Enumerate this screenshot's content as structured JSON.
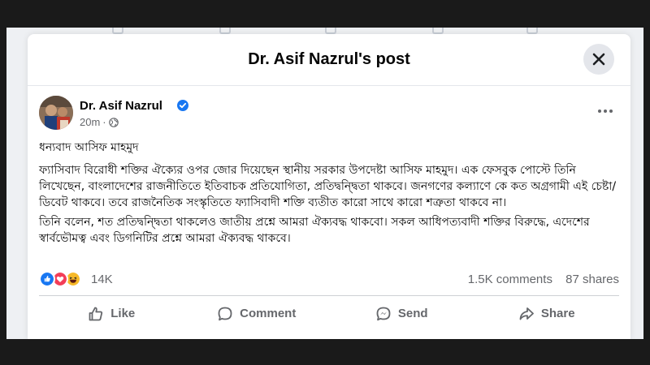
{
  "modal": {
    "title": "Dr. Asif Nazrul's post"
  },
  "post": {
    "author": "Dr. Asif Nazrul",
    "time": "20m",
    "dot": "·",
    "heading": "ধন্যবাদ আসিফ মাহমুদ",
    "lines": [
      "ফ্যাসিবাদ বিরোধী শক্তির ঐক্যের ওপর জোর দিয়েছেন স্থানীয় সরকার উপদেষ্টা আসিফ মাহমুদ। এক ফেসবুক পোস্টে তিনি লিখেছেন, বাংলাদেশের রাজনীতিতে ইতিবাচক প্রতিযোগিতা, প্রতিদ্বন্দ্বিতা থাকবে। জনগণের কল্যাণে কে কত অগ্রগামী এই চেষ্টা/ডিবেট থাকবে। তবে রাজনৈতিক সংস্কৃতিতে ফ্যাসিবাদী শক্তি ব্যতীত কারো সাথে কারো শত্রুতা থাকবে না।",
      "তিনি বলেন, শত প্রতিদ্বন্দ্বিতা থাকলেও জাতীয় প্রশ্নে আমরা ঐক্যবদ্ধ থাকবো। সকল আধিপত্যবাদী শক্তির বিরুদ্ধে, এদেশের স্বার্বভৌমত্ব এবং ডিগনিটির প্রশ্নে আমরা ঐক্যবদ্ধ থাকবে।"
    ],
    "reactions_count": "14K",
    "comments": "1.5K comments",
    "shares": "87 shares"
  },
  "actions": {
    "like": "Like",
    "comment": "Comment",
    "send": "Send",
    "share": "Share"
  },
  "colors": {
    "like_blue": "#1877f2",
    "love_red": "#f33e58",
    "haha_yellow": "#f7b928",
    "verified_blue": "#1877f2"
  },
  "icons": [
    "close-icon",
    "verified-icon",
    "globe-icon",
    "more-icon",
    "like-icon",
    "comment-icon",
    "send-icon",
    "share-icon"
  ]
}
